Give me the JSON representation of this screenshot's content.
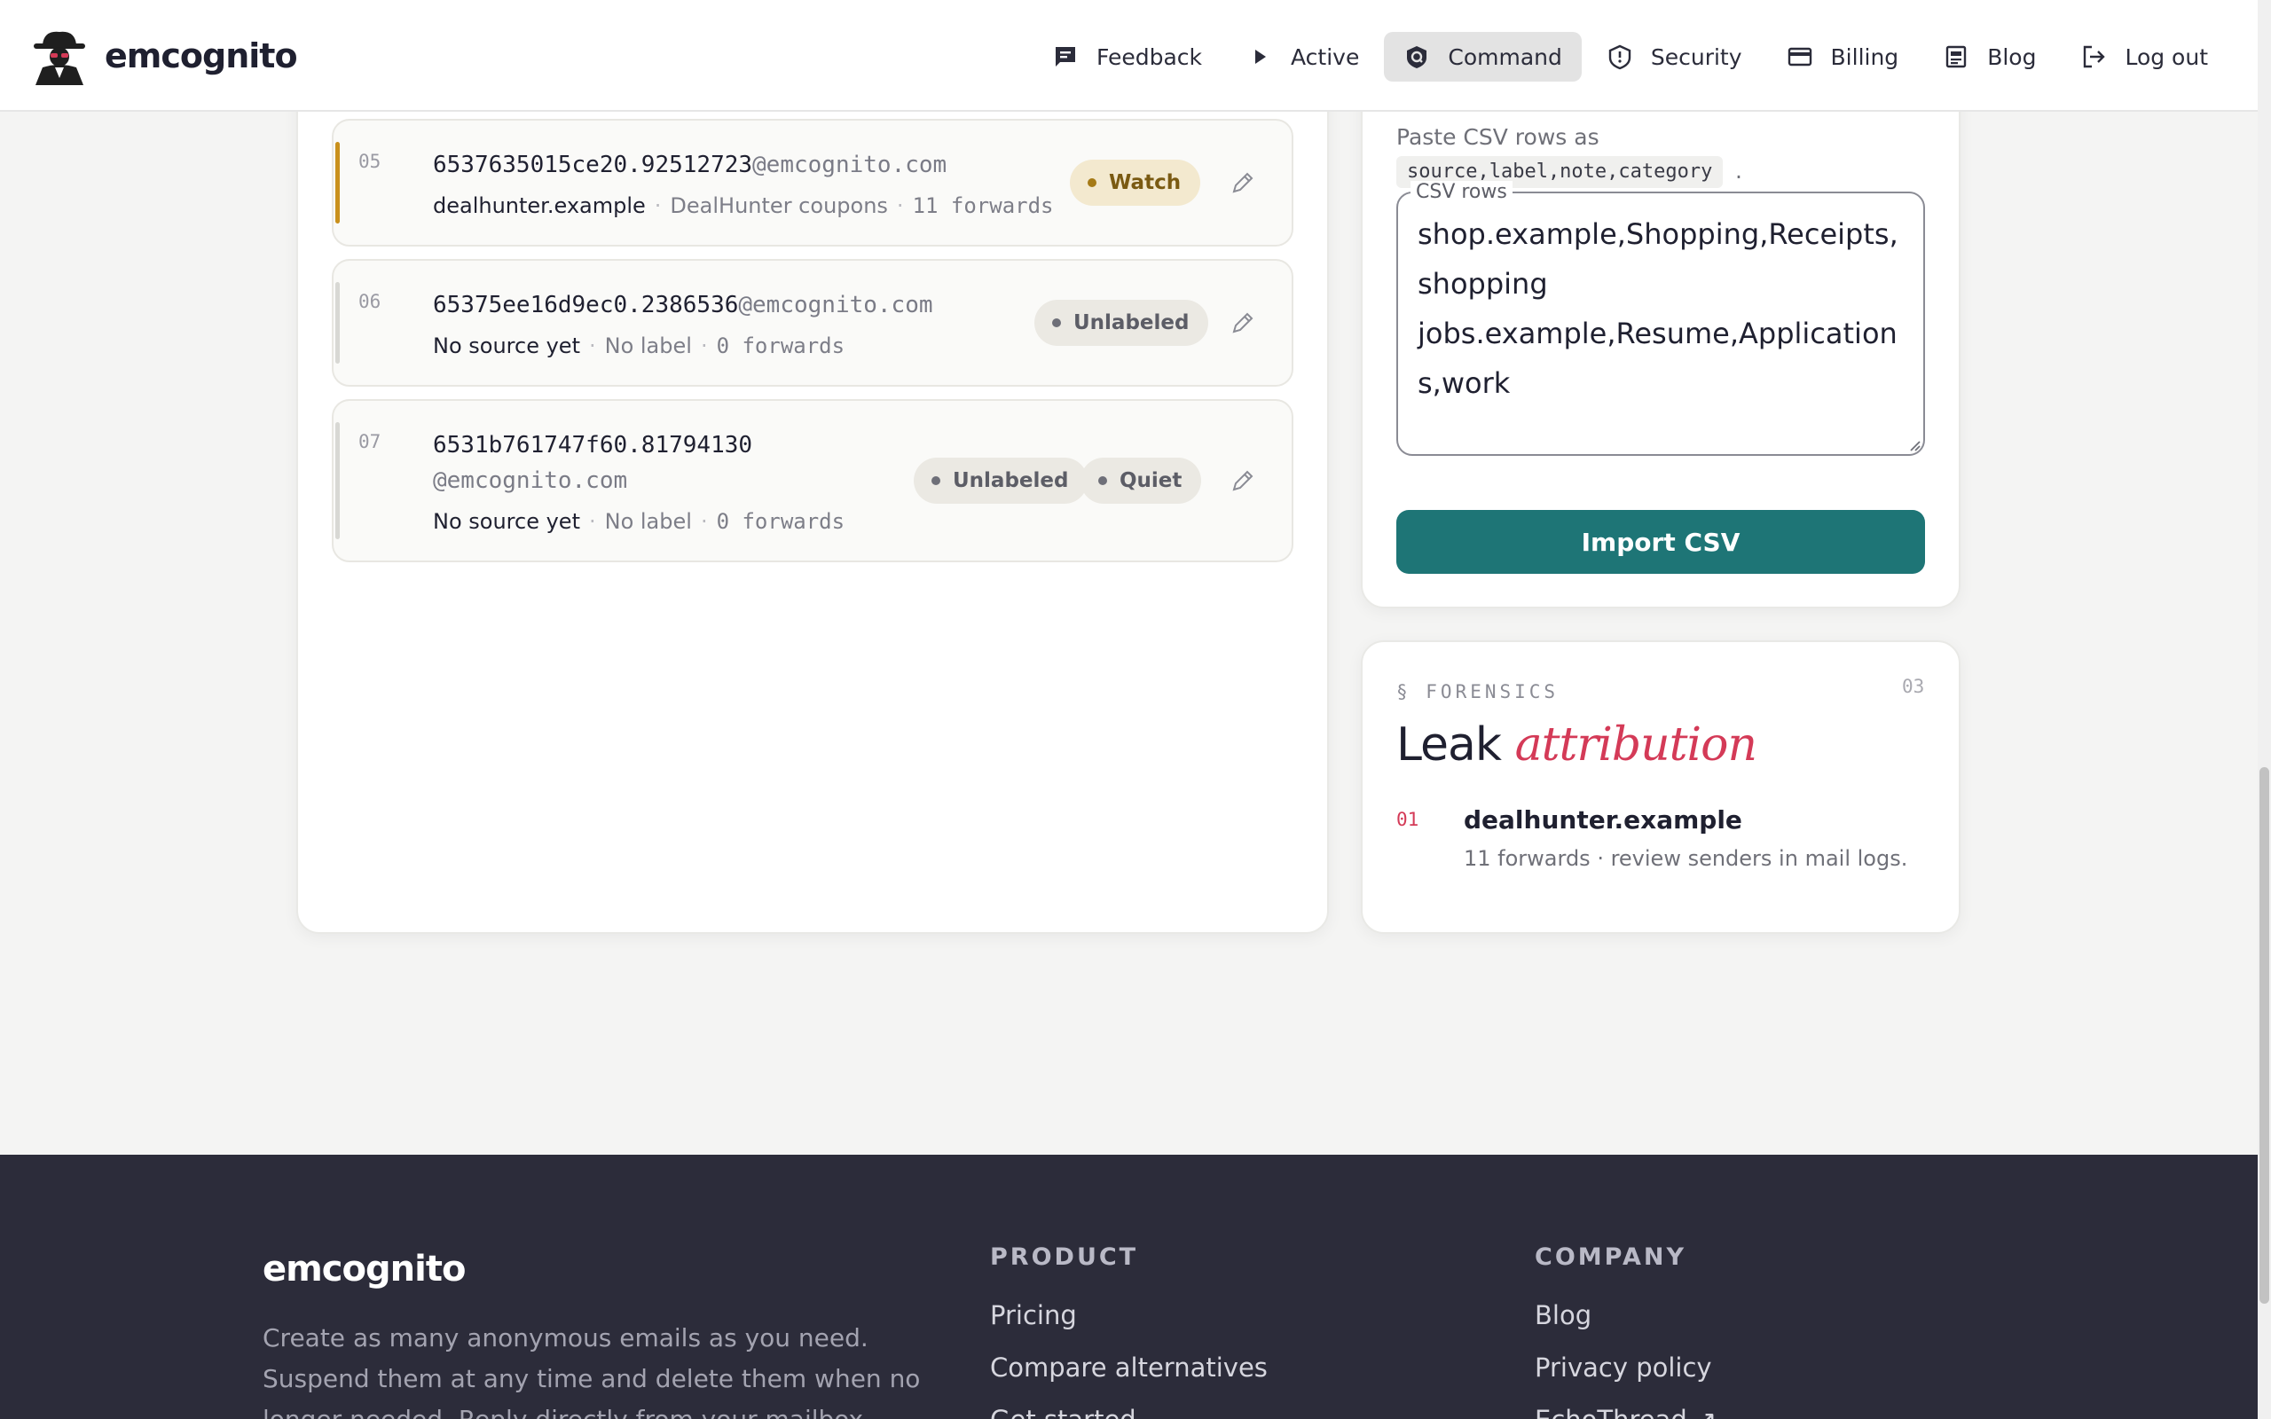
{
  "header": {
    "brand": "emcognito",
    "nav": [
      {
        "label": "Feedback",
        "icon": "feedback-icon"
      },
      {
        "label": "Active",
        "icon": "play-icon"
      },
      {
        "label": "Command",
        "icon": "command-icon",
        "active": true
      },
      {
        "label": "Security",
        "icon": "shield-icon"
      },
      {
        "label": "Billing",
        "icon": "card-icon"
      },
      {
        "label": "Blog",
        "icon": "blog-icon"
      },
      {
        "label": "Log out",
        "icon": "logout-icon"
      }
    ]
  },
  "aliases": [
    {
      "num": "05",
      "local": "6537635015ce20.92512723",
      "domain": "@emcognito.com",
      "source": "dealhunter.example",
      "label": "DealHunter coupons",
      "forwards": "11 forwards",
      "badges": [
        "Watch"
      ],
      "accent": "#c9901c"
    },
    {
      "num": "06",
      "local": "65375ee16d9ec0.2386536",
      "domain": "@emcognito.com",
      "source": "No source yet",
      "label": "No label",
      "forwards": "0 forwards",
      "badges": [
        "Unlabeled"
      ],
      "accent": "#d8d8d4"
    },
    {
      "num": "07",
      "local": "6531b761747f60.81794130",
      "domain": "@emcognito.com",
      "source": "No source yet",
      "label": "No label",
      "forwards": "0 forwards",
      "badges": [
        "Unlabeled",
        "Quiet"
      ],
      "accent": "#d8d8d4"
    }
  ],
  "import": {
    "hint": "Paste CSV rows as",
    "format": "source,label,note,category",
    "format_end": ".",
    "legend": "CSV rows",
    "value": "shop.example,Shopping,Receipts,shopping\njobs.example,Resume,Applications,work",
    "button": "Import CSV"
  },
  "forensics": {
    "kicker": "§ FORENSICS",
    "number": "03",
    "title_plain": "Leak",
    "title_accent": "attribution",
    "items": [
      {
        "num": "01",
        "source": "dealhunter.example",
        "detail": "11 forwards · review senders in mail logs."
      }
    ]
  },
  "footer": {
    "brand": "emcognito",
    "description": "Create as many anonymous emails as you need. Suspend them at any time and delete them when no longer needed. Reply directly from your mailbox — your",
    "product_title": "PRODUCT",
    "product_links": [
      "Pricing",
      "Compare alternatives",
      "Get started"
    ],
    "company_title": "COMPANY",
    "company_links": [
      "Blog",
      "Privacy policy",
      "EchoThread ↗"
    ]
  },
  "colors": {
    "accent": "#1e7576",
    "attribution": "#d43a57",
    "watch": "#c9901c",
    "footer_bg": "#2c2c3a"
  }
}
